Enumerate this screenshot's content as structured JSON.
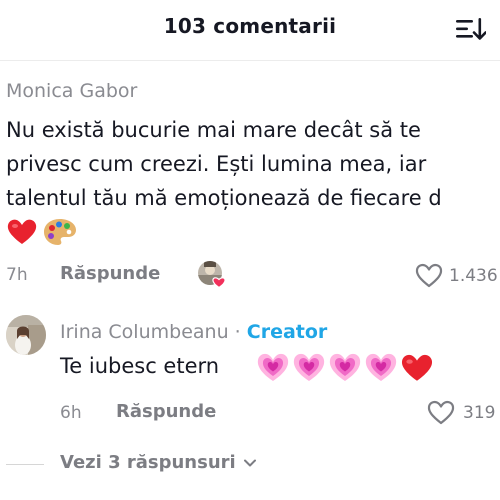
{
  "header": {
    "title": "103 comentarii",
    "sort_icon": "sort-descending-icon"
  },
  "comments": [
    {
      "author": "Monica Gabor",
      "text_lines": [
        "Nu există bucurie mai mare decât să te",
        "privesc cum creezi. Ești lumina mea, iar",
        "talentul tău mă emoționează de fiecare d"
      ],
      "emojis": [
        "red-heart-icon",
        "artist-palette-icon"
      ],
      "time": "7h",
      "reply_label": "Răspunde",
      "likes": "1.436",
      "liked_by_creator": true
    },
    {
      "author": "Irina Columbeanu",
      "separator": " · ",
      "badge": "Creator",
      "text": "Te iubesc etern",
      "emojis": [
        "growing-heart-icon",
        "growing-heart-icon",
        "growing-heart-icon",
        "growing-heart-icon",
        "red-heart-icon"
      ],
      "time": "6h",
      "reply_label": "Răspunde",
      "likes": "319"
    }
  ],
  "view_replies": {
    "label": "Vezi 3 răspunsuri",
    "icon": "chevron-down-icon"
  },
  "colors": {
    "text": "#161823",
    "muted": "#8a8b91",
    "creator_badge": "#20a6e6",
    "heart_red": "#e8222e",
    "heart_pink": "#f24fb6"
  }
}
